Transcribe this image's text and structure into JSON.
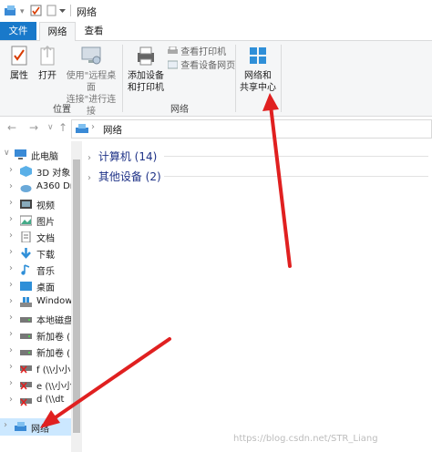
{
  "window": {
    "title": "网络"
  },
  "tabs": {
    "file": "文件",
    "network": "网络",
    "view": "查看"
  },
  "ribbon": {
    "properties": "属性",
    "open": "打开",
    "remote_desktop_line1": "使用\"远程桌面",
    "remote_desktop_line2": "连接\"进行连接",
    "location_group": "位置",
    "add_devices_line1": "添加设备",
    "add_devices_line2": "和打印机",
    "view_printers": "查看打印机",
    "view_device_webpage": "查看设备网页",
    "network_group": "网络",
    "network_sharing_line1": "网络和",
    "network_sharing_line2": "共享中心"
  },
  "address": {
    "path": "网络"
  },
  "nav": {
    "items": [
      {
        "label": "此电脑",
        "icon": "computer-icon"
      },
      {
        "label": "3D 对象",
        "icon": "3d-objects-icon"
      },
      {
        "label": "A360 Dr",
        "icon": "cloud-drive-icon"
      },
      {
        "label": "视频",
        "icon": "video-icon"
      },
      {
        "label": "图片",
        "icon": "picture-icon"
      },
      {
        "label": "文档",
        "icon": "document-icon"
      },
      {
        "label": "下载",
        "icon": "download-icon"
      },
      {
        "label": "音乐",
        "icon": "music-icon"
      },
      {
        "label": "桌面",
        "icon": "desktop-icon"
      },
      {
        "label": "Window",
        "icon": "windows-drive-icon"
      },
      {
        "label": "本地磁盘",
        "icon": "drive-icon"
      },
      {
        "label": "新加卷 (I",
        "icon": "drive-icon"
      },
      {
        "label": "新加卷 (I",
        "icon": "drive-icon"
      },
      {
        "label": "f (\\\\小小",
        "icon": "network-drive-icon"
      },
      {
        "label": "e (\\\\小小",
        "icon": "network-drive-icon"
      },
      {
        "label": "d (\\\\dt",
        "icon": "network-drive-icon"
      },
      {
        "label": "网络",
        "icon": "network-icon"
      }
    ]
  },
  "content": {
    "groups": [
      {
        "label": "计算机 (14)"
      },
      {
        "label": "其他设备 (2)"
      }
    ]
  },
  "watermark": "https://blog.csdn.net/STR_Liang",
  "colors": {
    "accent": "#1979ca",
    "selected": "#cce8ff",
    "arrow": "#e02020",
    "group_text": "#1e3287"
  }
}
